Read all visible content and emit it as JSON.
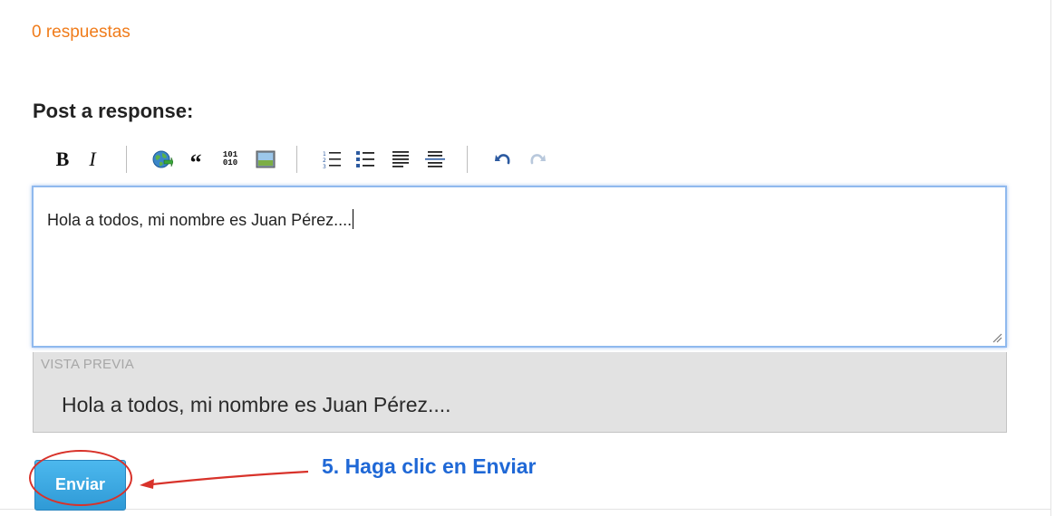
{
  "replies": {
    "count_label": "0 respuestas"
  },
  "form": {
    "heading": "Post a response:",
    "toolbar": {
      "bold": "B",
      "italic": "I",
      "quote": "“",
      "code_top": "101",
      "code_bottom": "010",
      "icons": [
        "bold-icon",
        "italic-icon",
        "link-globe-icon",
        "quote-icon",
        "code-icon",
        "image-icon",
        "ordered-list-icon",
        "unordered-list-icon",
        "align-left-icon",
        "horizontal-rule-icon",
        "undo-icon",
        "redo-icon"
      ]
    },
    "editor_value": "Hola a todos, mi nombre es Juan Pérez....",
    "preview": {
      "label": "VISTA PREVIA",
      "text": "Hola a todos, mi nombre es Juan Pérez...."
    },
    "submit_label": "Enviar"
  },
  "annotation": {
    "text": "5. Haga clic en Enviar",
    "color": "#1f68d6",
    "marker_color": "#d8322a"
  },
  "colors": {
    "accent_orange": "#f07c1b",
    "button_blue": "#3aa6e0",
    "focus_border": "#8fb9ee",
    "preview_bg": "#e2e2e2"
  }
}
